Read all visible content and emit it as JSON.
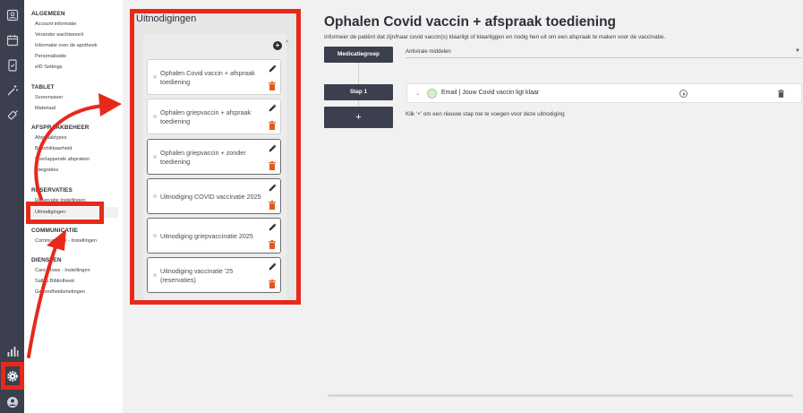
{
  "rail": {
    "icons": [
      "user-card-icon",
      "calendar-icon",
      "phone-check-icon",
      "magic-wand-icon",
      "syringe-icon",
      "bar-chart-icon",
      "gear-icon",
      "account-circle-icon"
    ]
  },
  "menu": {
    "sections": [
      {
        "title": "ALGEMEEN",
        "items": [
          "Account informatie",
          "Verander wachtwoord",
          "Informatie over de apotheek",
          "Personalisatie",
          "eID Settings"
        ]
      },
      {
        "title": "TABLET",
        "items": [
          "Screensaver",
          "Materiaal"
        ]
      },
      {
        "title": "AFSPRAAKBEHEER",
        "items": [
          "Afspraaktypes",
          "Beschikbaarheid",
          "Overlappende afspraken",
          "Integraties"
        ]
      },
      {
        "title": "RESERVATIES",
        "items": [
          "Reservatie Instellingen",
          "Uitnodigingen"
        ]
      },
      {
        "title": "COMMUNICATIE",
        "items": [
          "Communicatie - Instellingen"
        ]
      },
      {
        "title": "DIENSTEN",
        "items": [
          "Care Flows - Instellingen",
          "Sallvu Bibliotheek",
          "Gezondheidsmetingen"
        ]
      }
    ],
    "active_item": "Uitnodigingen"
  },
  "invitations": {
    "title": "Uitnodigingen",
    "items": [
      "Ophalen Covid vaccin + afspraak toediening",
      "Ophalen griepvaccin + afspraak toediening",
      "Ophalen griepvaccin + zonder toediening",
      "Uitnodiging COVID vaccinatie 2025",
      "Uitnodiging griepvaccinatie 2025",
      "Uitnodiging vaccinatie '25 (reservaties)"
    ]
  },
  "detail": {
    "title": "Ophalen Covid vaccin + afspraak toediening",
    "subtitle": "Informeer de patiënt dat zijn/haar covid vaccin(s) klaarligt of klaarliggen en nodig hen uit om een afspraak te maken voor de vaccinatie.",
    "group_button": "Medicatiegroep",
    "group_value": "Antivirale middelen",
    "step_button": "Stap 1",
    "step_label": "Email | Jouw Covid vaccin ligt klaar",
    "add_button": "+",
    "add_hint": "Klik '+' om een nieuwe stap toe te voegen voor deze uitnodiging"
  },
  "colors": {
    "rail": "#3c3f4d",
    "annotation_red": "#e8281b",
    "delete_orange": "#e05a1c",
    "page_bg": "#f1f1f1"
  }
}
